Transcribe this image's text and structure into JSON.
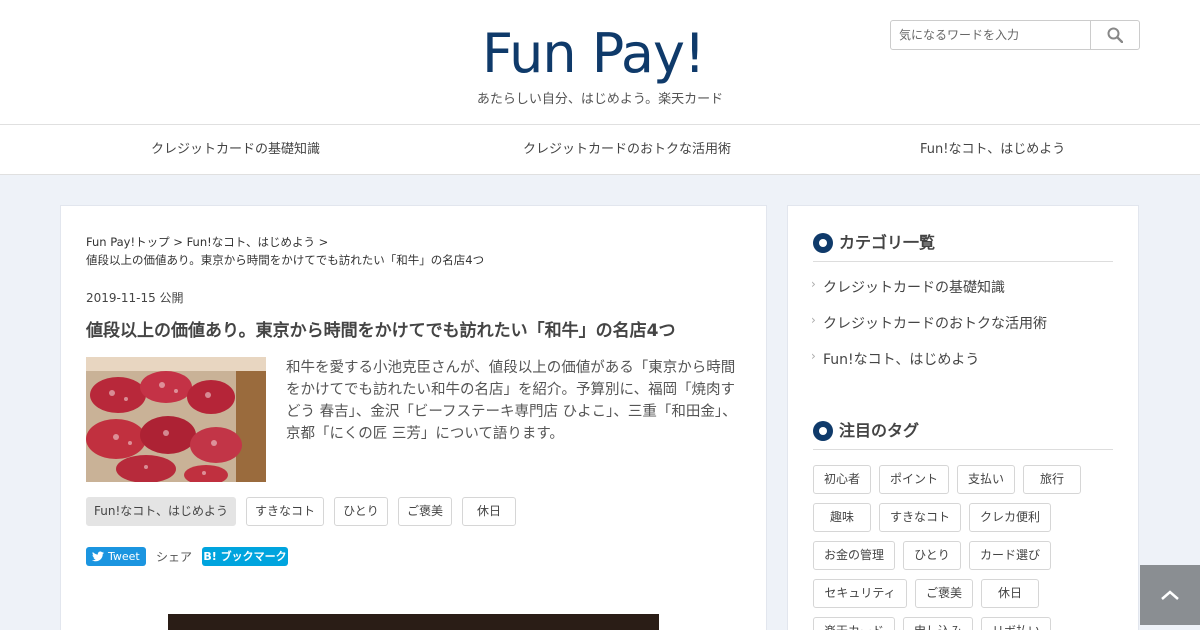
{
  "header": {
    "logo_text": "Fun Pay!",
    "tagline": "あたらしい自分、はじめよう。楽天カード",
    "search": {
      "placeholder": "気になるワードを入力",
      "icon": "search-icon"
    },
    "brand_color": "#0f3a6a"
  },
  "nav": {
    "items": [
      {
        "label": "クレジットカードの基礎知識"
      },
      {
        "label": "クレジットカードのおトクな活用術"
      },
      {
        "label": "Fun!なコト、はじめよう"
      }
    ]
  },
  "article": {
    "breadcrumb": {
      "home": "Fun Pay!トップ",
      "sep1": " > ",
      "category": "Fun!なコト、はじめよう",
      "sep2": " >",
      "current": "値段以上の価値あり。東京から時間をかけてでも訪れたい「和牛」の名店4つ"
    },
    "date": "2019-11-15 公開",
    "title": "値段以上の価値あり。東京から時間をかけてでも訪れたい「和牛」の名店4つ",
    "excerpt": "和牛を愛する小池克臣さんが、値段以上の価値がある「東京から時間をかけてでも訪れたい和牛の名店」を紹介。予算別に、福岡「焼肉すどう 春吉」、金沢「ビーフステーキ専門店 ひよこ」、三重「和田金」、京都「にくの匠 三芳」について語ります。",
    "tags": [
      {
        "label": "Fun!なコト、はじめよう"
      },
      {
        "label": "すきなコト"
      },
      {
        "label": "ひとり"
      },
      {
        "label": "ご褒美"
      },
      {
        "label": "休日"
      }
    ],
    "share": {
      "tweet_label": "Tweet",
      "share_label": "シェア",
      "hatena_label": "B! ブックマーク"
    }
  },
  "sidebar": {
    "categories_title": "カテゴリ一覧",
    "categories": [
      {
        "label": "クレジットカードの基礎知識"
      },
      {
        "label": "クレジットカードのおトクな活用術"
      },
      {
        "label": "Fun!なコト、はじめよう"
      }
    ],
    "tags_title": "注目のタグ",
    "tags": [
      {
        "label": "初心者"
      },
      {
        "label": "ポイント"
      },
      {
        "label": "支払い"
      },
      {
        "label": "旅行"
      },
      {
        "label": "趣味"
      },
      {
        "label": "すきなコト"
      },
      {
        "label": "クレカ便利"
      },
      {
        "label": "お金の管理"
      },
      {
        "label": "ひとり"
      },
      {
        "label": "カード選び"
      },
      {
        "label": "セキュリティ"
      },
      {
        "label": "ご褒美"
      },
      {
        "label": "休日"
      },
      {
        "label": "楽天カード"
      },
      {
        "label": "申し込み"
      },
      {
        "label": "リボ払い"
      }
    ]
  },
  "back_to_top": {
    "icon": "chevron-up-icon"
  }
}
